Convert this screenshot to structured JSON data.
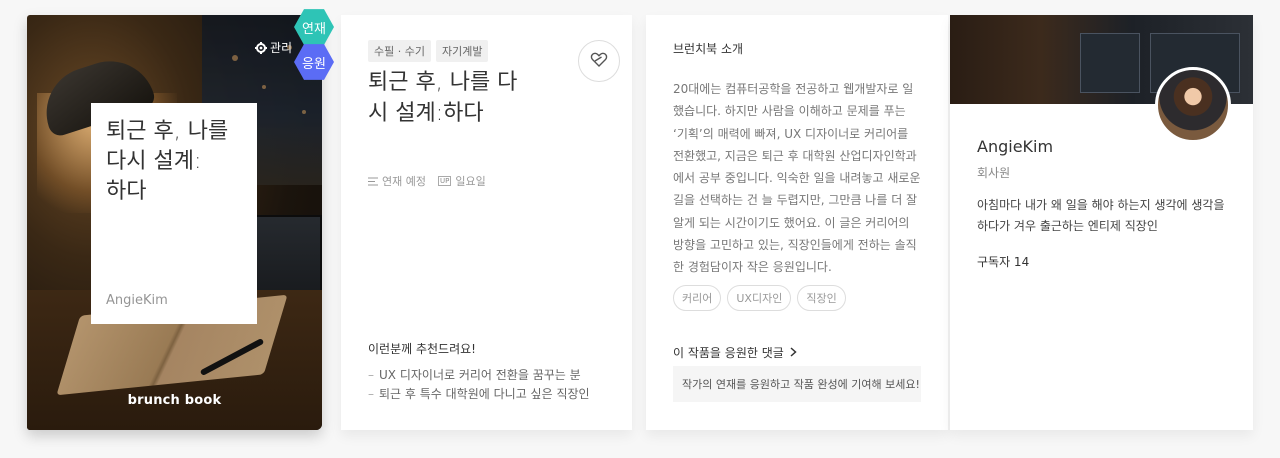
{
  "cover": {
    "title": "퇴근 후, 나를\n다시 설계:\n하다",
    "author": "AngieKim",
    "brand": "brunch book",
    "manage_label": "관리"
  },
  "badges": {
    "serial": "연재",
    "support": "응원"
  },
  "details": {
    "tags": [
      "수필 · 수기",
      "자기계발"
    ],
    "title": "퇴근 후, 나를 다시 설계:하다",
    "meta": {
      "status": "연재 예정",
      "day_icon": "UP",
      "day": "일요일"
    },
    "recommend_title": "이런분께 추천드려요!",
    "recommend_items": [
      "UX 디자이너로 커리어 전환을 꿈꾸는 분",
      "퇴근 후 특수 대학원에 다니고 싶은 직장인"
    ]
  },
  "intro": {
    "title": "브런치북 소개",
    "body": "20대에는 컴퓨터공학을 전공하고 웹개발자로 일했습니다. 하지만 사람을 이해하고 문제를 푸는 ‘기획’의 매력에 빠져, UX 디자이너로 커리어를 전환했고, 지금은 퇴근 후 대학원 산업디자인학과에서 공부 중입니다. 익숙한 일을 내려놓고 새로운 길을 선택하는 건 늘 두렵지만, 그만큼 나를 더 잘 알게 되는 시간이기도 했어요. 이 글은 커리어의 방향을 고민하고 있는, 직장인들에게 전하는 솔직한 경험담이자 작은 응원입니다.",
    "keywords": [
      "커리어",
      "UX디자인",
      "직장인"
    ],
    "comments_link": "이 작품을 응원한 댓글",
    "comments_prompt": "작가의 연재를 응원하고 작품 완성에 기여해 보세요!"
  },
  "author": {
    "name": "AngieKim",
    "job": "회사원",
    "bio": "아침마다 내가 왜 일을 해야 하는지 생각에 생각을 하다가 겨우 출근하는 엔티제 직장인",
    "subscribers": "구독자 14"
  },
  "colors": {
    "serial_badge": "#2ec4b6",
    "support_badge": "#5b6cf5"
  },
  "icons": [
    "gear-icon",
    "heart-pin-icon",
    "list-icon",
    "up-icon",
    "chevron-right-icon"
  ]
}
